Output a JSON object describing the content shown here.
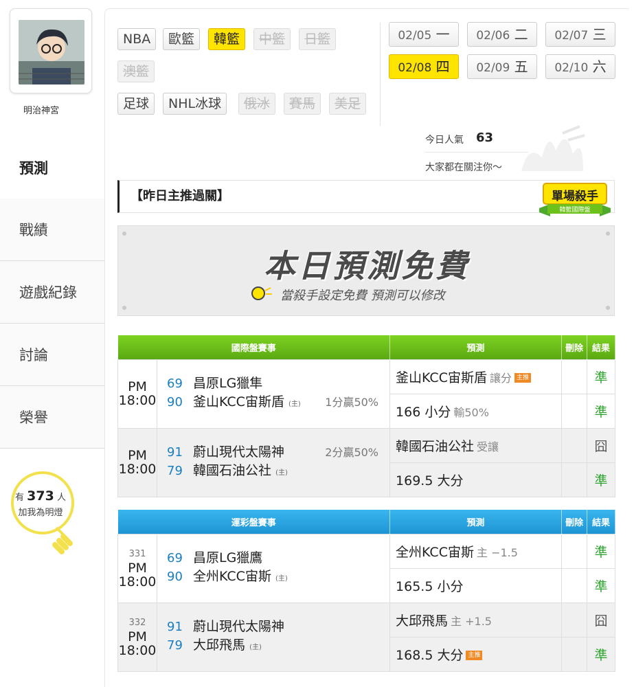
{
  "profile": {
    "name": "明治神宮"
  },
  "sidebar": {
    "items": [
      {
        "label": "預測",
        "active": true
      },
      {
        "label": "戰績"
      },
      {
        "label": "遊戲紀錄"
      },
      {
        "label": "討論"
      },
      {
        "label": "榮譽"
      }
    ],
    "fans": {
      "prefix": "有",
      "count": "373",
      "suffix": "人",
      "line2": "加我為明燈"
    }
  },
  "leagues": {
    "row1": [
      {
        "label": "NBA",
        "state": "normal"
      },
      {
        "label": "歐籃",
        "state": "normal"
      },
      {
        "label": "韓籃",
        "state": "active"
      },
      {
        "label": "中籃",
        "state": "disabled"
      },
      {
        "label": "日籃",
        "state": "disabled"
      }
    ],
    "row2": [
      {
        "label": "澳籃",
        "state": "disabled"
      }
    ],
    "row3": [
      {
        "label": "足球",
        "state": "normal"
      },
      {
        "label": "NHL冰球",
        "state": "normal"
      },
      {
        "label": "俄冰",
        "state": "disabled"
      },
      {
        "label": "賽馬",
        "state": "disabled"
      },
      {
        "label": "美足",
        "state": "disabled"
      }
    ]
  },
  "dates": [
    {
      "md": "02/05",
      "wd": "一",
      "active": false
    },
    {
      "md": "02/06",
      "wd": "二",
      "active": false
    },
    {
      "md": "02/07",
      "wd": "三",
      "active": false
    },
    {
      "md": "02/08",
      "wd": "四",
      "active": true
    },
    {
      "md": "02/09",
      "wd": "五",
      "active": false
    },
    {
      "md": "02/10",
      "wd": "六",
      "active": false
    }
  ],
  "popularity": {
    "label": "今日人氣",
    "value": "63",
    "sub": "大家都在關注你～"
  },
  "yesterday": {
    "label": "【昨日主推過關】"
  },
  "badge": {
    "title": "單場殺手",
    "subtitle": "韓籃國際盤"
  },
  "free": {
    "title": "本日預測免費",
    "subtitle": "當殺手設定免費 預測可以修改"
  },
  "intl_table": {
    "headers": {
      "game": "國際盤賽事",
      "pick": "預測",
      "del": "刪除",
      "result": "結果"
    },
    "games": [
      {
        "time": "PM 18:00",
        "away": {
          "num": "69",
          "name": "昌原LG獵隼"
        },
        "home": {
          "num": "90",
          "name": "釜山KCC宙斯盾",
          "mark": "(主)"
        },
        "handicap": "1分贏50%",
        "handicap_row": "home",
        "picks": [
          {
            "main": "釜山KCC宙斯盾",
            "sub": "讓分",
            "tag": "主推",
            "result": "準"
          },
          {
            "main": "166 小分",
            "sub": "輸50%",
            "tag": "",
            "result": "準"
          }
        ]
      },
      {
        "time": "PM 18:00",
        "away": {
          "num": "91",
          "name": "蔚山現代太陽神"
        },
        "home": {
          "num": "79",
          "name": "韓國石油公社",
          "mark": "(主)"
        },
        "handicap": "2分贏50%",
        "handicap_row": "away",
        "picks": [
          {
            "main": "韓國石油公社",
            "sub": "受讓",
            "tag": "",
            "result": "囧"
          },
          {
            "main": "169.5 大分",
            "sub": "",
            "tag": "",
            "result": "準"
          }
        ]
      }
    ]
  },
  "lottery_table": {
    "headers": {
      "game": "運彩盤賽事",
      "pick": "預測",
      "del": "刪除",
      "result": "結果"
    },
    "games": [
      {
        "id": "331",
        "time": "PM 18:00",
        "away": {
          "num": "69",
          "name": "昌原LG獵鷹"
        },
        "home": {
          "num": "90",
          "name": "全州KCC宙斯",
          "mark": "(主)"
        },
        "picks": [
          {
            "main": "全州KCC宙斯",
            "sub": "主 −1.5",
            "tag": "",
            "result": "準"
          },
          {
            "main": "165.5 小分",
            "sub": "",
            "tag": "",
            "result": "準"
          }
        ]
      },
      {
        "id": "332",
        "time": "PM 18:00",
        "away": {
          "num": "91",
          "name": "蔚山現代太陽神"
        },
        "home": {
          "num": "79",
          "name": "大邱飛馬",
          "mark": "(主)"
        },
        "picks": [
          {
            "main": "大邱飛馬",
            "sub": "主 +1.5",
            "tag": "",
            "result": "囧"
          },
          {
            "main": "168.5 大分",
            "sub": "",
            "tag": "主推",
            "result": "準"
          }
        ]
      }
    ]
  },
  "colors": {
    "accent": "#ffe400",
    "green_header": "#6cc11a",
    "blue_header": "#2aa6e2",
    "win": "#2ea42e"
  }
}
